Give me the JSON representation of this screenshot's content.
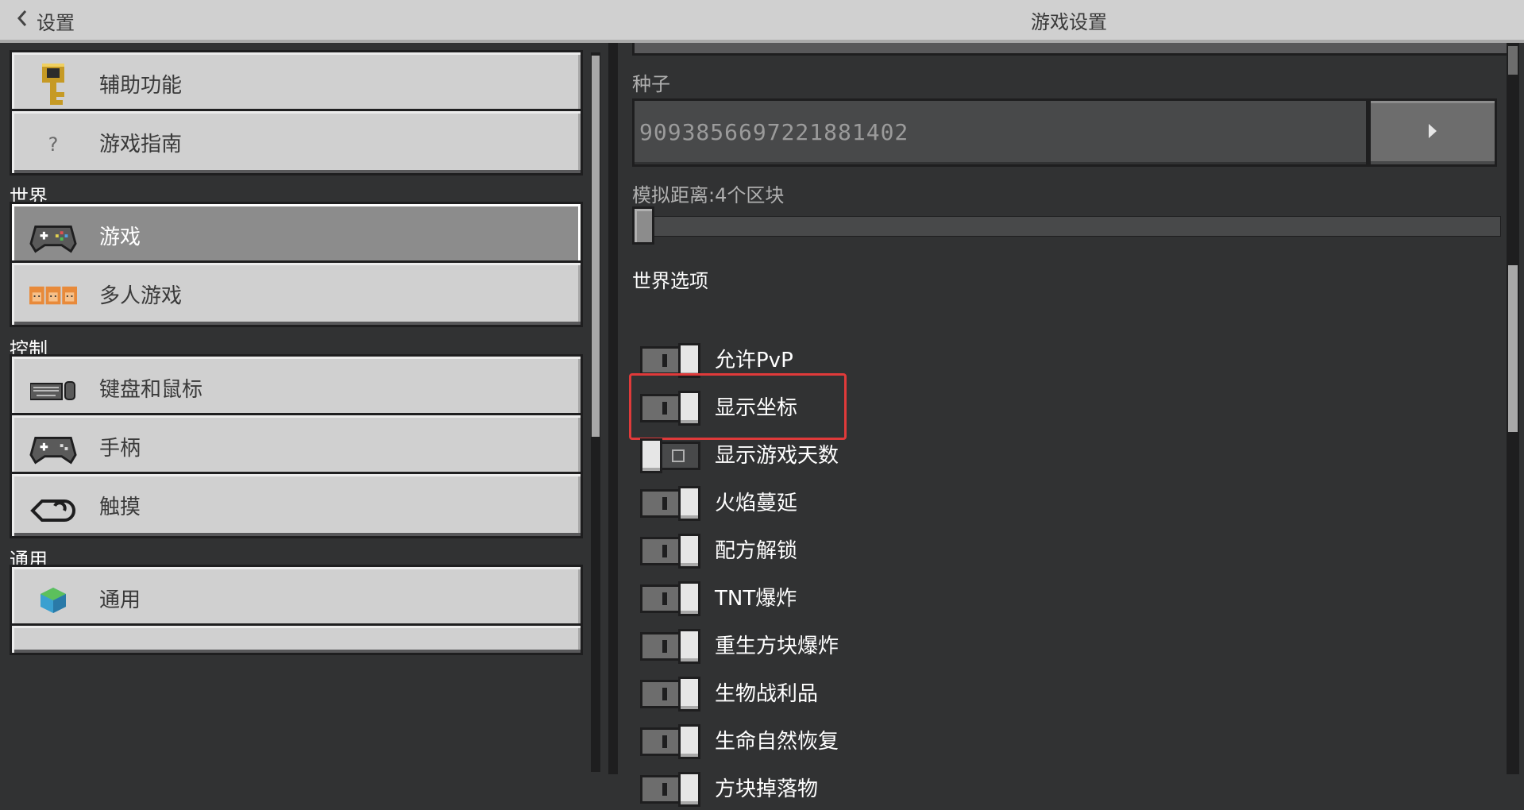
{
  "header": {
    "back_label": "设置",
    "page_title": "游戏设置"
  },
  "sidebar": {
    "general_items": [
      {
        "label": "辅助功能",
        "icon": "key-icon"
      },
      {
        "label": "游戏指南",
        "icon": "question-icon"
      }
    ],
    "sections": [
      {
        "title": "世界",
        "items": [
          {
            "label": "游戏",
            "icon": "controller-icon",
            "selected": true
          },
          {
            "label": "多人游戏",
            "icon": "players-icon"
          }
        ]
      },
      {
        "title": "控制",
        "items": [
          {
            "label": "键盘和鼠标",
            "icon": "keyboard-mouse-icon"
          },
          {
            "label": "手柄",
            "icon": "gamepad-icon"
          },
          {
            "label": "触摸",
            "icon": "touch-icon"
          }
        ]
      },
      {
        "title": "通用",
        "items": [
          {
            "label": "通用",
            "icon": "globe-icon"
          }
        ]
      }
    ]
  },
  "content": {
    "seed": {
      "label": "种子",
      "value": "9093856697221881402"
    },
    "simulation_distance": {
      "label": "模拟距离:4个区块",
      "value": 4
    },
    "world_options": {
      "title": "世界选项",
      "options": [
        {
          "label": "允许PvP",
          "enabled": true
        },
        {
          "label": "显示坐标",
          "enabled": true,
          "highlighted": true
        },
        {
          "label": "显示游戏天数",
          "enabled": false
        },
        {
          "label": "火焰蔓延",
          "enabled": true
        },
        {
          "label": "配方解锁",
          "enabled": true
        },
        {
          "label": "TNT爆炸",
          "enabled": true
        },
        {
          "label": "重生方块爆炸",
          "enabled": true
        },
        {
          "label": "生物战利品",
          "enabled": true
        },
        {
          "label": "生命自然恢复",
          "enabled": true
        },
        {
          "label": "方块掉落物",
          "enabled": true
        }
      ]
    }
  },
  "colors": {
    "highlight": "#e03a3a",
    "panel": "#313233",
    "button": "#d0d0d0"
  }
}
